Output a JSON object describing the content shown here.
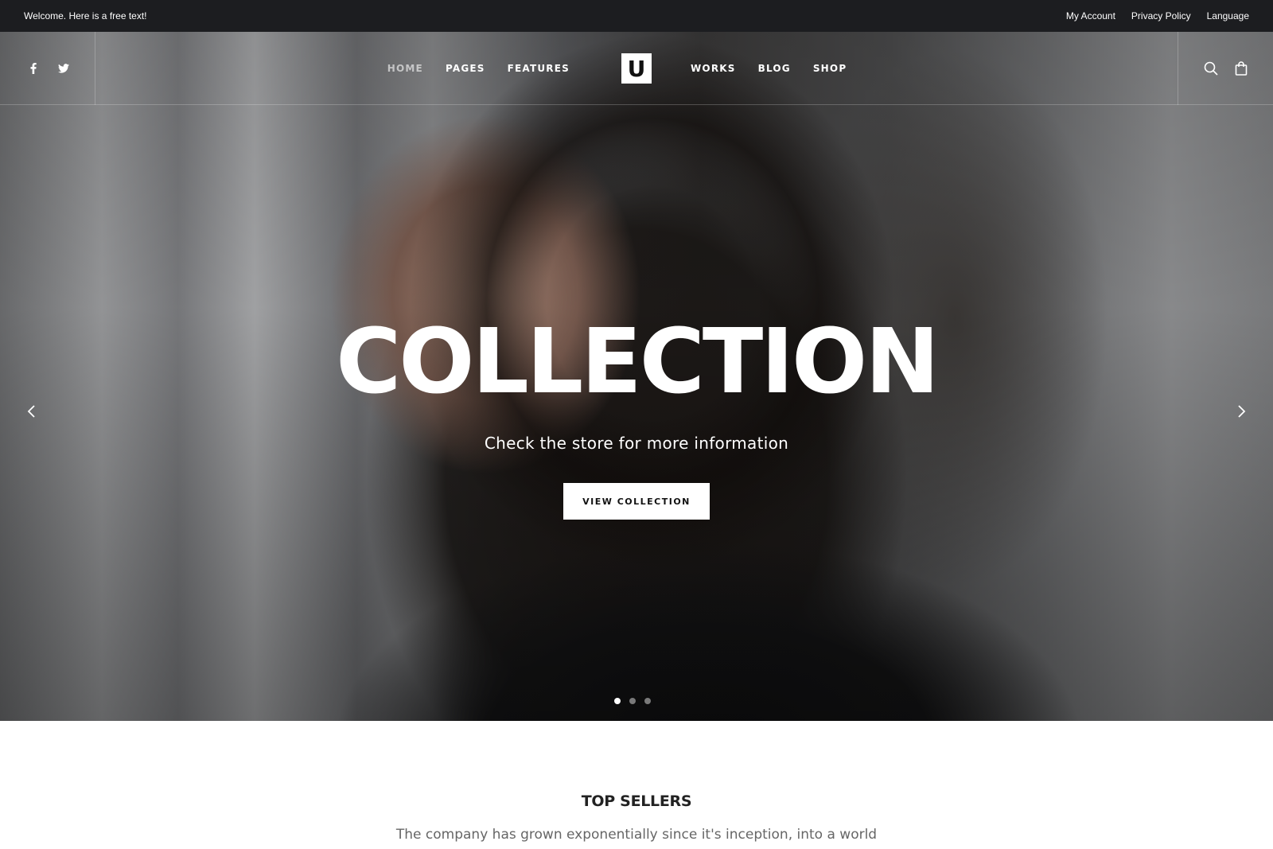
{
  "topbar": {
    "welcome": "Welcome. Here is a free text!",
    "links": [
      "My Account",
      "Privacy Policy",
      "Language"
    ]
  },
  "social": {
    "icons": [
      "facebook-icon",
      "twitter-icon"
    ]
  },
  "nav": {
    "left": [
      "HOME",
      "PAGES",
      "FEATURES"
    ],
    "right": [
      "WORKS",
      "BLOG",
      "SHOP"
    ],
    "active": "HOME",
    "logo": "U"
  },
  "tools": {
    "icons": [
      "search-icon",
      "shopping-bag-icon"
    ]
  },
  "hero": {
    "title": "COLLECTION",
    "subtitle": "Check the store for more information",
    "button": "VIEW COLLECTION",
    "slides_total": 3,
    "active_slide": 1
  },
  "section": {
    "title": "TOP SELLERS",
    "text": "The company has grown exponentially since it's inception, into a world"
  },
  "colors": {
    "topbar_bg": "#1c1d20",
    "text_white": "#ffffff",
    "muted_text": "#666666"
  }
}
